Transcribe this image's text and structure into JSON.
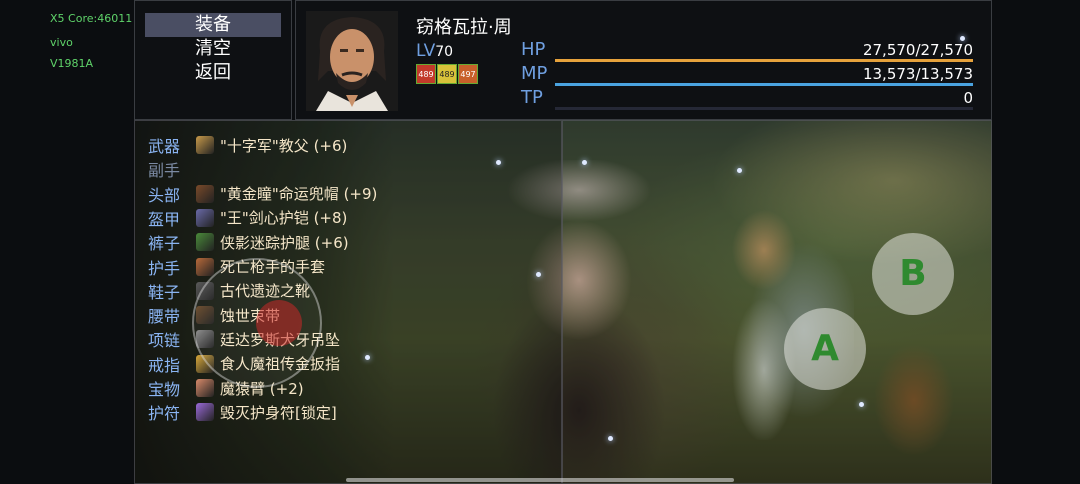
{
  "system": {
    "core": "X5 Core:46011",
    "brand": "vivo",
    "model": "V1981A"
  },
  "menu": {
    "items": [
      "装备",
      "清空",
      "返回"
    ],
    "selected_index": 0
  },
  "character": {
    "name": "窃格瓦拉·周",
    "level_label": "LV",
    "level": "70",
    "states": [
      {
        "text": "489",
        "color": "#c23a2a"
      },
      {
        "text": "489",
        "color": "#d8c23a"
      },
      {
        "text": "497",
        "color": "#c8602a"
      }
    ],
    "hp": {
      "label": "HP",
      "value": "27,570/27,570",
      "fraction": 1.0,
      "color": "#e6a23c"
    },
    "mp": {
      "label": "MP",
      "value": "13,573/13,573",
      "fraction": 1.0,
      "color": "#4aa3e0"
    },
    "tp": {
      "label": "TP",
      "value": "0",
      "fraction": 0.0,
      "color": "#6bd36b"
    }
  },
  "equipment": [
    {
      "slot": "武器",
      "item": "\"十字军\"教父 (+6)",
      "icon_color": "#c89a4a",
      "icon": "sword-icon"
    },
    {
      "slot": "副手",
      "item": "",
      "icon_color": "",
      "icon": ""
    },
    {
      "slot": "头部",
      "item": "\"黄金瞳\"命运兜帽 (+9)",
      "icon_color": "#7a4a2a",
      "icon": "hood-icon"
    },
    {
      "slot": "盔甲",
      "item": "\"王\"剑心护铠 (+8)",
      "icon_color": "#6a6aa8",
      "icon": "armor-icon"
    },
    {
      "slot": "裤子",
      "item": "侠影迷踪护腿 (+6)",
      "icon_color": "#4a8a3a",
      "icon": "leggings-icon"
    },
    {
      "slot": "护手",
      "item": "死亡枪手的手套",
      "icon_color": "#b86a3a",
      "icon": "gloves-icon"
    },
    {
      "slot": "鞋子",
      "item": "古代遗迹之靴",
      "icon_color": "#5a5a5a",
      "icon": "boots-icon"
    },
    {
      "slot": "腰带",
      "item": "蚀世束带",
      "icon_color": "#6a4a2a",
      "icon": "belt-icon"
    },
    {
      "slot": "项链",
      "item": "廷达罗斯犬牙吊坠",
      "icon_color": "#8a8a8a",
      "icon": "necklace-icon"
    },
    {
      "slot": "戒指",
      "item": "食人魔祖传金扳指",
      "icon_color": "#d8a83a",
      "icon": "ring-icon"
    },
    {
      "slot": "宝物",
      "item": "魔猿臂 (+2)",
      "icon_color": "#d88a6a",
      "icon": "arm-icon"
    },
    {
      "slot": "护符",
      "item": "毁灭护身符[锁定]",
      "icon_color": "#9a6ad8",
      "icon": "amulet-icon"
    }
  ],
  "controls": {
    "button_b": "B",
    "button_a": "A"
  }
}
